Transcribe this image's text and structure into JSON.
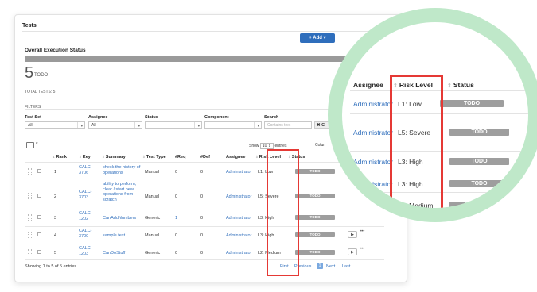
{
  "header": {
    "title": "Tests",
    "add_button": "+ Add ▾"
  },
  "overall": {
    "title": "Overall Execution Status",
    "count": "5",
    "count_status": "TODO",
    "total_label": "TOTAL TESTS: 5"
  },
  "filters": {
    "label": "FILTERS",
    "test_set": {
      "label": "Test Set",
      "value": "All"
    },
    "assignee": {
      "label": "Assignee",
      "value": "All"
    },
    "status": {
      "label": "Status",
      "value": ""
    },
    "component": {
      "label": "Component",
      "value": ""
    },
    "search": {
      "label": "Search",
      "placeholder": "Contains text"
    },
    "clear_label": "✖ C"
  },
  "table_controls": {
    "show_prefix": "Show",
    "show_value": "10 ⇕",
    "show_suffix": "entries",
    "columns_label": "Colun"
  },
  "columns": {
    "rank": "Rank",
    "key": "Key",
    "summary": "Summary",
    "test_type": "Test Type",
    "req": "#Req",
    "def": "#Def",
    "assignee": "Assignee",
    "risk_level": "Risk Level",
    "status": "Status"
  },
  "rows": [
    {
      "rank": "1",
      "key": "CALC-3706",
      "summary": "check the history of operations",
      "test_type": "Manual",
      "req": "0",
      "def": "0",
      "assignee": "Administrator",
      "risk_level": "L1: Low",
      "status": "TODO"
    },
    {
      "rank": "2",
      "key": "CALC-3703",
      "summary": "ability to perform, clear / start new operations from scratch",
      "test_type": "Manual",
      "req": "0",
      "def": "0",
      "assignee": "Administrator",
      "risk_level": "L5: Severe",
      "status": "TODO"
    },
    {
      "rank": "3",
      "key": "CALC-1202",
      "summary": "CanAddNumbers",
      "test_type": "Generic",
      "req": "1",
      "def": "0",
      "assignee": "Administrator",
      "risk_level": "L3: High",
      "status": "TODO"
    },
    {
      "rank": "4",
      "key": "CALC-3700",
      "summary": "sample test",
      "test_type": "Manual",
      "req": "0",
      "def": "0",
      "assignee": "Administrator",
      "risk_level": "L3: High",
      "status": "TODO"
    },
    {
      "rank": "5",
      "key": "CALC-1203",
      "summary": "CanDoStuff",
      "test_type": "Generic",
      "req": "0",
      "def": "0",
      "assignee": "Administrator",
      "risk_level": "L2: Medium",
      "status": "TODO"
    }
  ],
  "footer": {
    "showing": "Showing 1 to 5 of 5 entries",
    "first": "First",
    "previous": "Previous",
    "current_page": "1",
    "next": "Next",
    "last": "Last"
  },
  "icons": {
    "play": "▶",
    "more": "•••",
    "sort": "⇕"
  },
  "colors": {
    "accent": "#2f6ebc",
    "highlight": "#e53935",
    "todo": "#9e9e9e",
    "circle": "#bfe8c9"
  }
}
